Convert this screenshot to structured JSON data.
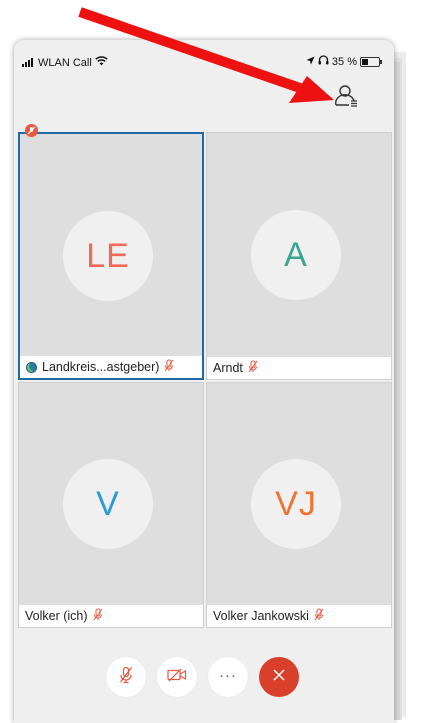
{
  "statusbar": {
    "carrier": "WLAN Call",
    "battery": "35 %"
  },
  "participants": [
    {
      "initials": "LE",
      "name": "Landkreis...astgeber)",
      "color": "#f0695a",
      "host": true,
      "muted": true,
      "active": true
    },
    {
      "initials": "A",
      "name": "Arndt",
      "color": "#3aa58f",
      "host": false,
      "muted": true,
      "active": false
    },
    {
      "initials": "V",
      "name": "Volker (ich)",
      "color": "#2d9ad6",
      "host": false,
      "muted": true,
      "active": false
    },
    {
      "initials": "VJ",
      "name": "Volker Jankowski",
      "color": "#f0732f",
      "host": false,
      "muted": true,
      "active": false
    }
  ],
  "controls": {
    "more_label": "···"
  },
  "colors": {
    "accent": "#1f6aa8",
    "end_call": "#d9402b",
    "mute_icon": "#e8573f",
    "annotation_arrow": "#ee1111"
  },
  "icons": [
    "signal-icon",
    "wifi-icon",
    "location-icon",
    "headphones-icon",
    "battery-icon",
    "participants-list-icon",
    "muted-mic-icon",
    "video-off-icon",
    "more-icon",
    "end-call-icon"
  ]
}
